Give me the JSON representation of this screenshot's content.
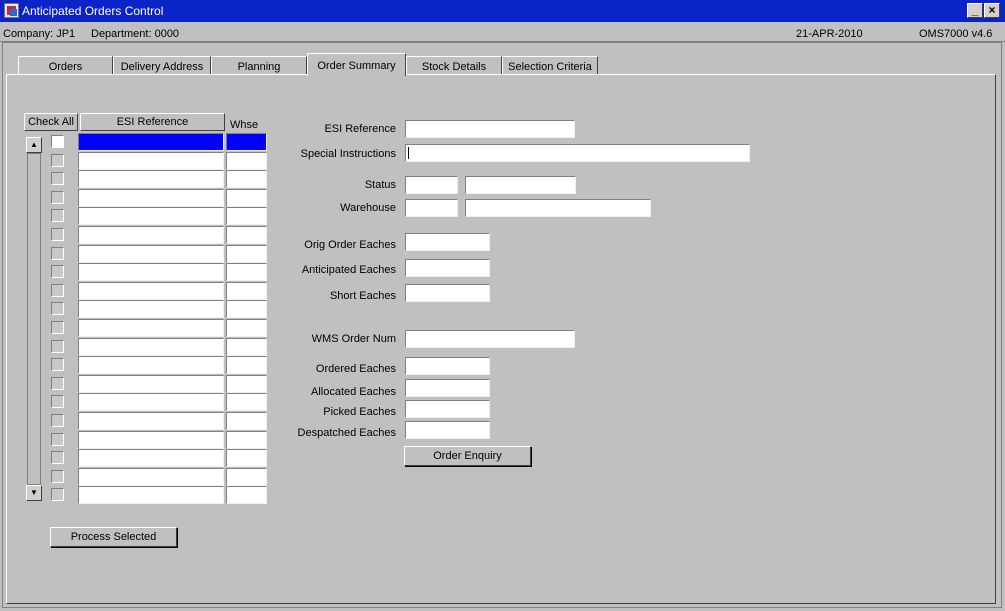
{
  "window": {
    "title": "Anticipated Orders Control",
    "minimize": "_",
    "close": "×"
  },
  "status": {
    "company": "Company:  JP1",
    "department": "Department:  0000",
    "date": "21-APR-2010",
    "version": "OMS7000  v4.6"
  },
  "tabs": [
    {
      "label": "Orders",
      "active": false
    },
    {
      "label": "Delivery Address",
      "active": false
    },
    {
      "label": "Planning",
      "active": false
    },
    {
      "label": "Order Summary",
      "active": true
    },
    {
      "label": "Stock Details",
      "active": false
    },
    {
      "label": "Selection Criteria",
      "active": false
    }
  ],
  "list": {
    "check_all": "Check All",
    "col_ref": "ESI Reference",
    "col_whse": "Whse",
    "scroll_up": "▲",
    "scroll_down": "▼",
    "row_count": 20
  },
  "form": {
    "esi_reference": "ESI Reference",
    "special_instructions": "Special Instructions",
    "status": "Status",
    "warehouse": "Warehouse",
    "orig_order_eaches": "Orig Order Eaches",
    "anticipated_eaches": "Anticipated Eaches",
    "short_eaches": "Short Eaches",
    "wms_order_num": "WMS Order Num",
    "ordered_eaches": "Ordered Eaches",
    "allocated_eaches": "Allocated Eaches",
    "picked_eaches": "Picked Eaches",
    "despatched_eaches": "Despatched Eaches"
  },
  "buttons": {
    "order_enquiry": "Order Enquiry",
    "process_selected": "Process Selected"
  }
}
